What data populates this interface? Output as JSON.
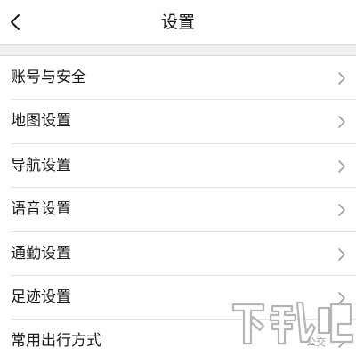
{
  "header": {
    "title": "设置",
    "back_icon": "chevron-left-icon"
  },
  "settings": {
    "items": [
      {
        "label": "账号与安全",
        "icon": "chevron-right-icon"
      },
      {
        "label": "地图设置",
        "icon": "chevron-right-icon"
      },
      {
        "label": "导航设置",
        "icon": "chevron-right-icon"
      },
      {
        "label": "语音设置",
        "icon": "chevron-right-icon"
      },
      {
        "label": "通勤设置",
        "icon": "chevron-right-icon"
      },
      {
        "label": "足迹设置",
        "icon": "chevron-right-icon"
      },
      {
        "label": "常用出行方式",
        "icon": "chevron-right-icon",
        "value": "公交"
      }
    ]
  },
  "watermark": {
    "text": "下载吧"
  },
  "colors": {
    "background": "#ffffff",
    "section_gap": "#efeff1",
    "divider": "#e3e3e5",
    "text": "#1a1a1a",
    "chevron": "#9e9e9e"
  }
}
